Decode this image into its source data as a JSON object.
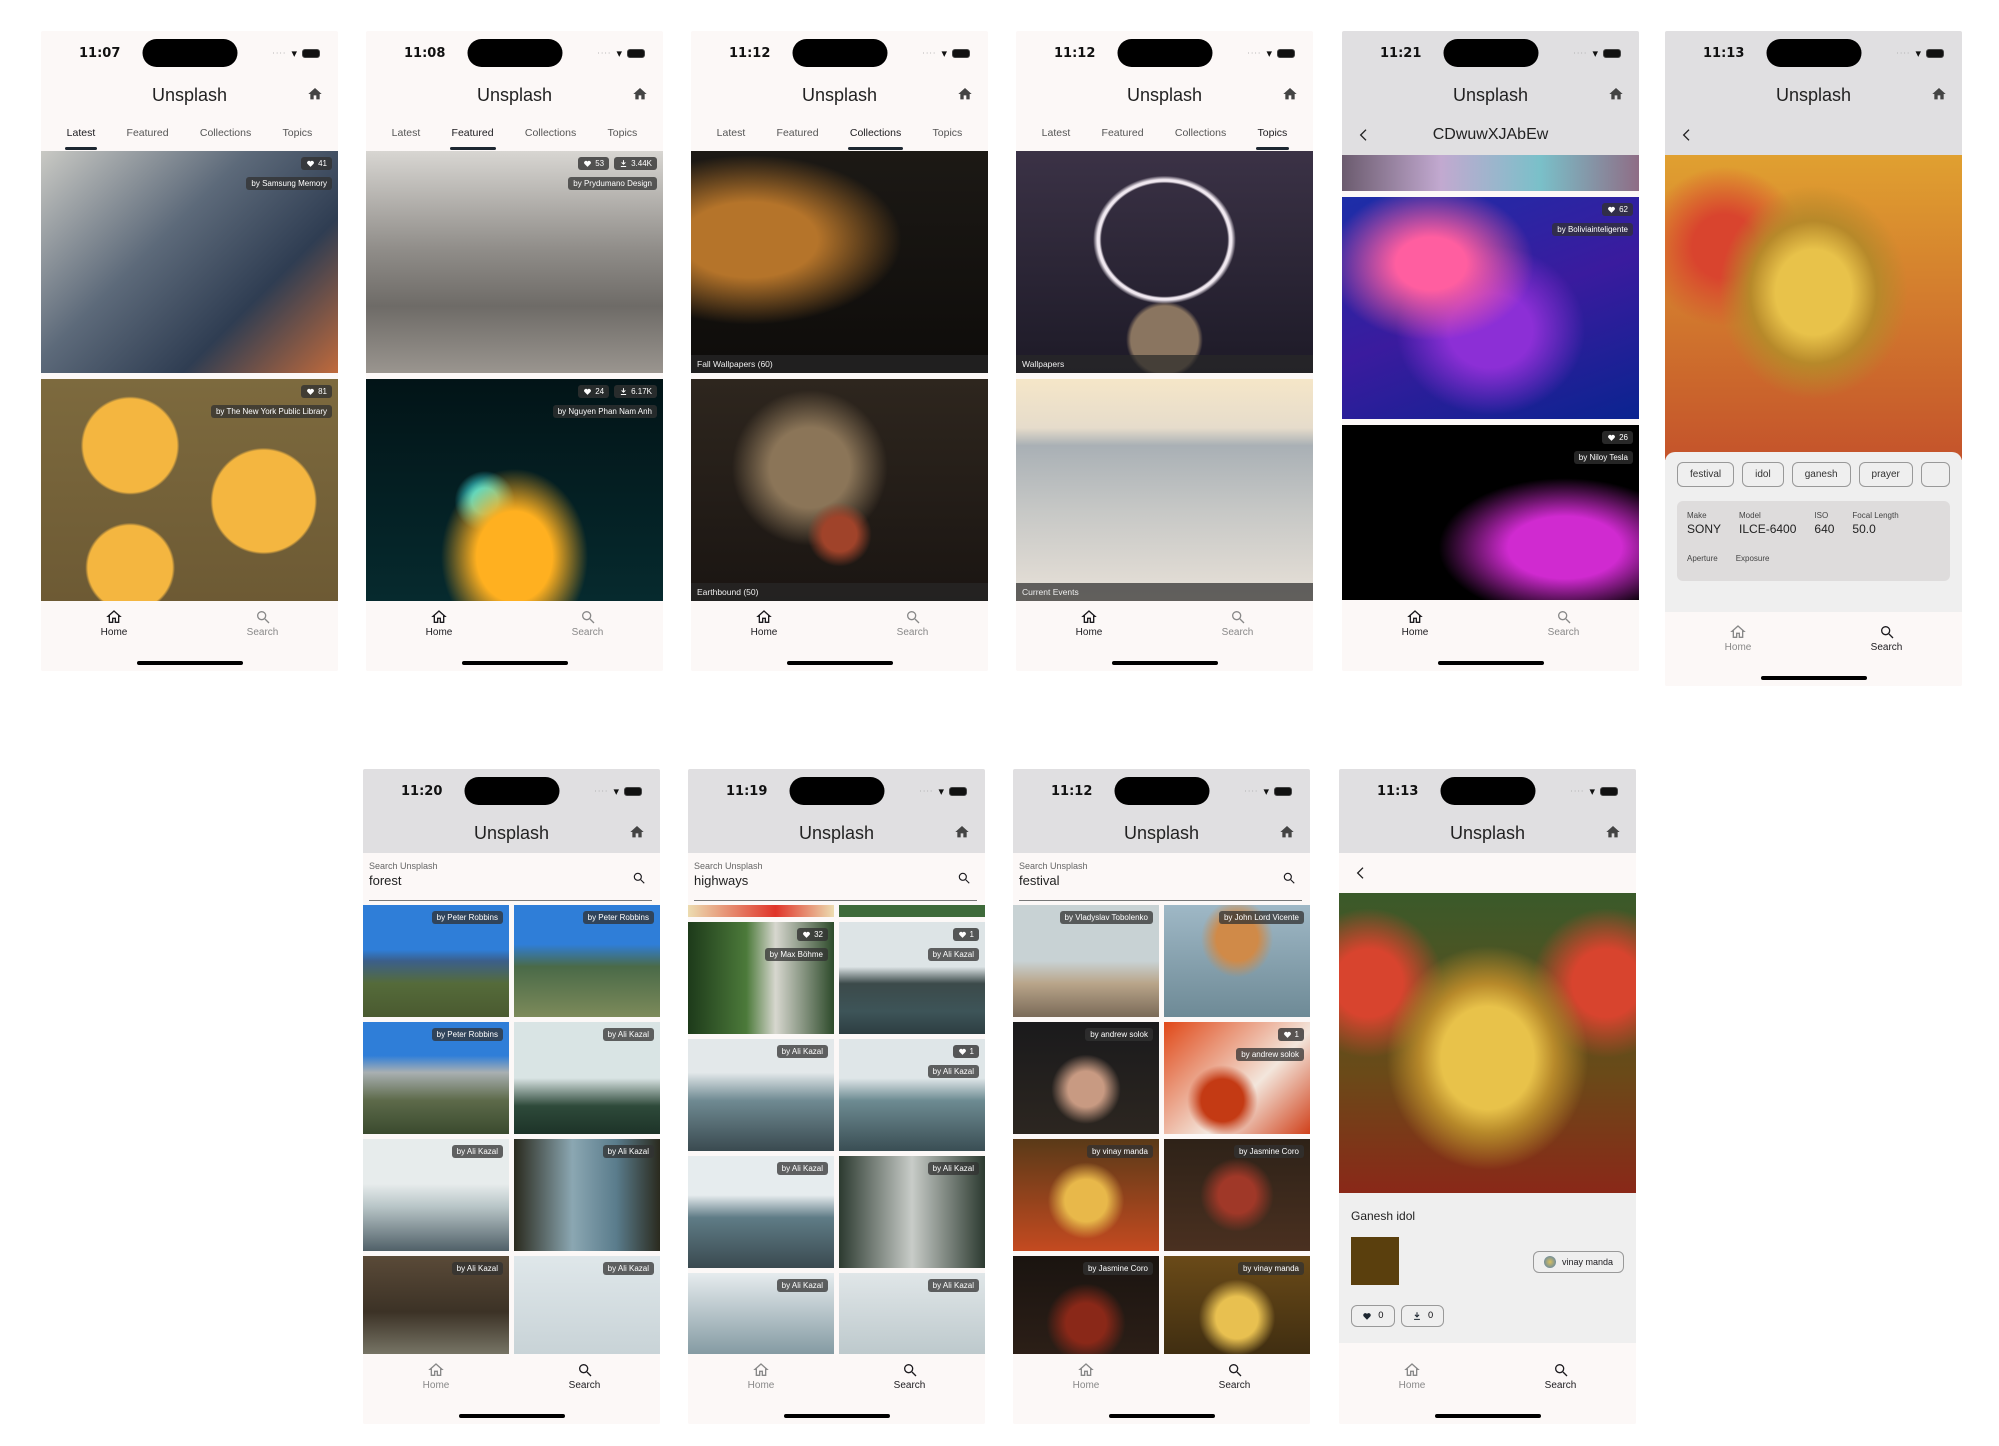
{
  "app": {
    "title": "Unsplash"
  },
  "tabs": [
    "Latest",
    "Featured",
    "Collections",
    "Topics"
  ],
  "nav": {
    "home": "Home",
    "search": "Search"
  },
  "search": {
    "label": "Search Unsplash"
  },
  "colors": {
    "accent": "#1d2731",
    "surface": "#fcf8f7",
    "appbar_gray": "#e0dfe1",
    "swatch": "#5a3f0d"
  },
  "screens": [
    {
      "time": "11:07",
      "active_tab": "Latest",
      "cards": [
        {
          "likes": "41",
          "credit": "by Samsung Memory"
        },
        {
          "likes": "81",
          "credit": "by The New York Public Library"
        }
      ]
    },
    {
      "time": "11:08",
      "active_tab": "Featured",
      "cards": [
        {
          "likes": "53",
          "downloads": "3.44K",
          "credit": "by Prydumano Design"
        },
        {
          "likes": "24",
          "downloads": "6.17K",
          "credit": "by Nguyen Phan Nam Anh"
        }
      ]
    },
    {
      "time": "11:12",
      "active_tab": "Collections",
      "cards": [
        {
          "caption": "Fall Wallpapers  (60)"
        },
        {
          "caption": "Earthbound  (50)"
        }
      ]
    },
    {
      "time": "11:12",
      "active_tab": "Topics",
      "cards": [
        {
          "caption": "Wallpapers"
        },
        {
          "caption": "Current Events"
        }
      ]
    },
    {
      "time": "11:21",
      "collection_title": "CDwuwXJAbEw",
      "cards": [
        {
          "likes": "62",
          "credit": "by Boliviainteligente"
        },
        {
          "likes": "26",
          "credit": "by Niloy Tesla"
        }
      ]
    },
    {
      "time": "11:13",
      "tags": [
        "festival",
        "idol",
        "ganesh",
        "prayer"
      ],
      "exif": [
        {
          "k": "Make",
          "v": "SONY"
        },
        {
          "k": "Model",
          "v": "ILCE-6400"
        },
        {
          "k": "ISO",
          "v": "640"
        },
        {
          "k": "Focal Length",
          "v": "50.0"
        }
      ],
      "exif2": [
        "Aperture",
        "Exposure"
      ]
    },
    {
      "time": "11:20",
      "query": "forest",
      "results": [
        "by Peter Robbins",
        "by Peter Robbins",
        "by Peter Robbins",
        "by Ali Kazal",
        "by Ali Kazal",
        "by Ali Kazal",
        "by Ali Kazal",
        "by Ali Kazal"
      ]
    },
    {
      "time": "11:19",
      "query": "highways",
      "results": [
        {
          "credit": "by Max Böhme",
          "likes": "32"
        },
        {
          "credit": "by Ali Kazal",
          "likes": "1"
        },
        {
          "credit": "by Ali Kazal"
        },
        {
          "credit": "by Ali Kazal",
          "likes": "1"
        },
        {
          "credit": "by Ali Kazal"
        },
        {
          "credit": "by Ali Kazal"
        },
        {
          "credit": "by Ali Kazal"
        },
        {
          "credit": "by Ali Kazal"
        }
      ]
    },
    {
      "time": "11:12",
      "query": "festival",
      "results": [
        {
          "credit": "by Vladyslav Tobolenko"
        },
        {
          "credit": "by John Lord Vicente"
        },
        {
          "credit": "by andrew solok"
        },
        {
          "credit": "by andrew solok",
          "likes": "1"
        },
        {
          "credit": "by vinay manda"
        },
        {
          "credit": "by Jasmine Coro"
        },
        {
          "credit": "by Jasmine Coro"
        },
        {
          "credit": "by vinay manda"
        }
      ]
    },
    {
      "time": "11:13",
      "photo_title": "Ganesh idol",
      "user": "vinay manda",
      "likes": "0",
      "downloads": "0"
    }
  ]
}
